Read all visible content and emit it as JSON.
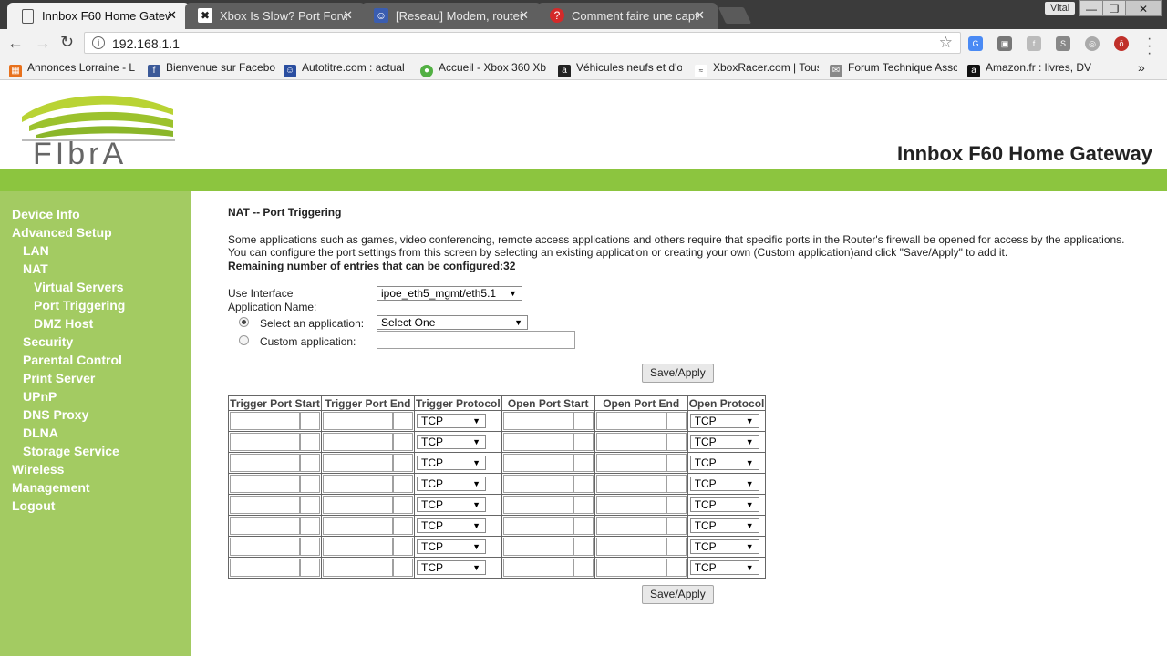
{
  "browser": {
    "tabs": [
      {
        "title": "Innbox F60 Home Gatew",
        "icon": "page-icon",
        "active": true
      },
      {
        "title": "Xbox Is Slow? Port Forwa",
        "icon": "xbox-site-icon",
        "active": false
      },
      {
        "title": "[Reseau] Modem, routeu",
        "icon": "forum-site-icon",
        "active": false
      },
      {
        "title": "Comment faire une captu",
        "icon": "question-site-icon",
        "active": false
      }
    ],
    "profile_name": "Vital",
    "url": "192.168.1.1",
    "bookmarks": [
      {
        "label": "Annonces Lorraine - L",
        "icon": "annonces-icon",
        "color": "#e8711c"
      },
      {
        "label": "Bienvenue sur Facebo",
        "icon": "facebook-icon",
        "color": "#3b5998"
      },
      {
        "label": "Autotitre.com : actual",
        "icon": "autotitre-icon",
        "color": "#2a4ea0"
      },
      {
        "label": "Accueil - Xbox 360 Xb",
        "icon": "xbox360-icon",
        "color": "#52b043"
      },
      {
        "label": "Véhicules neufs et d'o",
        "icon": "amazon-a-icon",
        "color": "#222222"
      },
      {
        "label": "XboxRacer.com | Tous",
        "icon": "xboxracer-icon",
        "color": "#333333"
      },
      {
        "label": "Forum Technique Asso",
        "icon": "forum-technique-icon",
        "color": "#666666"
      },
      {
        "label": "Amazon.fr : livres, DV",
        "icon": "amazon-icon",
        "color": "#111111"
      }
    ]
  },
  "router": {
    "product_name": "Innbox F60 Home Gateway",
    "brand_logo_text": "FIbrA",
    "menu": [
      {
        "label": "Device Info",
        "level": 0
      },
      {
        "label": "Advanced Setup",
        "level": 0
      },
      {
        "label": "LAN",
        "level": 1
      },
      {
        "label": "NAT",
        "level": 1
      },
      {
        "label": "Virtual Servers",
        "level": 2
      },
      {
        "label": "Port Triggering",
        "level": 2
      },
      {
        "label": "DMZ Host",
        "level": 2
      },
      {
        "label": "Security",
        "level": 1
      },
      {
        "label": "Parental Control",
        "level": 1
      },
      {
        "label": "Print Server",
        "level": 1
      },
      {
        "label": "UPnP",
        "level": 1
      },
      {
        "label": "DNS Proxy",
        "level": 1
      },
      {
        "label": "DLNA",
        "level": 1
      },
      {
        "label": "Storage Service",
        "level": 1
      },
      {
        "label": "Wireless",
        "level": 0
      },
      {
        "label": "Management",
        "level": 0
      },
      {
        "label": "Logout",
        "level": 0
      }
    ],
    "page": {
      "title": "NAT -- Port Triggering",
      "description": "Some applications such as games, video conferencing, remote access applications and others require that specific ports in the Router's firewall be opened for access by the applications. You can configure the port settings from this screen by selecting an existing application or creating your own (Custom application)and click \"Save/Apply\" to add it.",
      "remaining": "Remaining number of entries that can be configured:32",
      "use_interface_label": "Use Interface",
      "use_interface_value": "ipoe_eth5_mgmt/eth5.1",
      "app_name_label": "Application Name:",
      "select_app_label": "Select an application:",
      "select_app_value": "Select One",
      "custom_app_label": "Custom application:",
      "custom_app_value": "",
      "save_label": "Save/Apply",
      "table": {
        "headers": [
          "Trigger Port Start",
          "Trigger Port End",
          "Trigger Protocol",
          "Open Port Start",
          "Open Port End",
          "Open Protocol"
        ],
        "rows": [
          {
            "trigger_protocol": "TCP",
            "open_protocol": "TCP"
          },
          {
            "trigger_protocol": "TCP",
            "open_protocol": "TCP"
          },
          {
            "trigger_protocol": "TCP",
            "open_protocol": "TCP"
          },
          {
            "trigger_protocol": "TCP",
            "open_protocol": "TCP"
          },
          {
            "trigger_protocol": "TCP",
            "open_protocol": "TCP"
          },
          {
            "trigger_protocol": "TCP",
            "open_protocol": "TCP"
          },
          {
            "trigger_protocol": "TCP",
            "open_protocol": "TCP"
          },
          {
            "trigger_protocol": "TCP",
            "open_protocol": "TCP"
          }
        ]
      }
    }
  }
}
